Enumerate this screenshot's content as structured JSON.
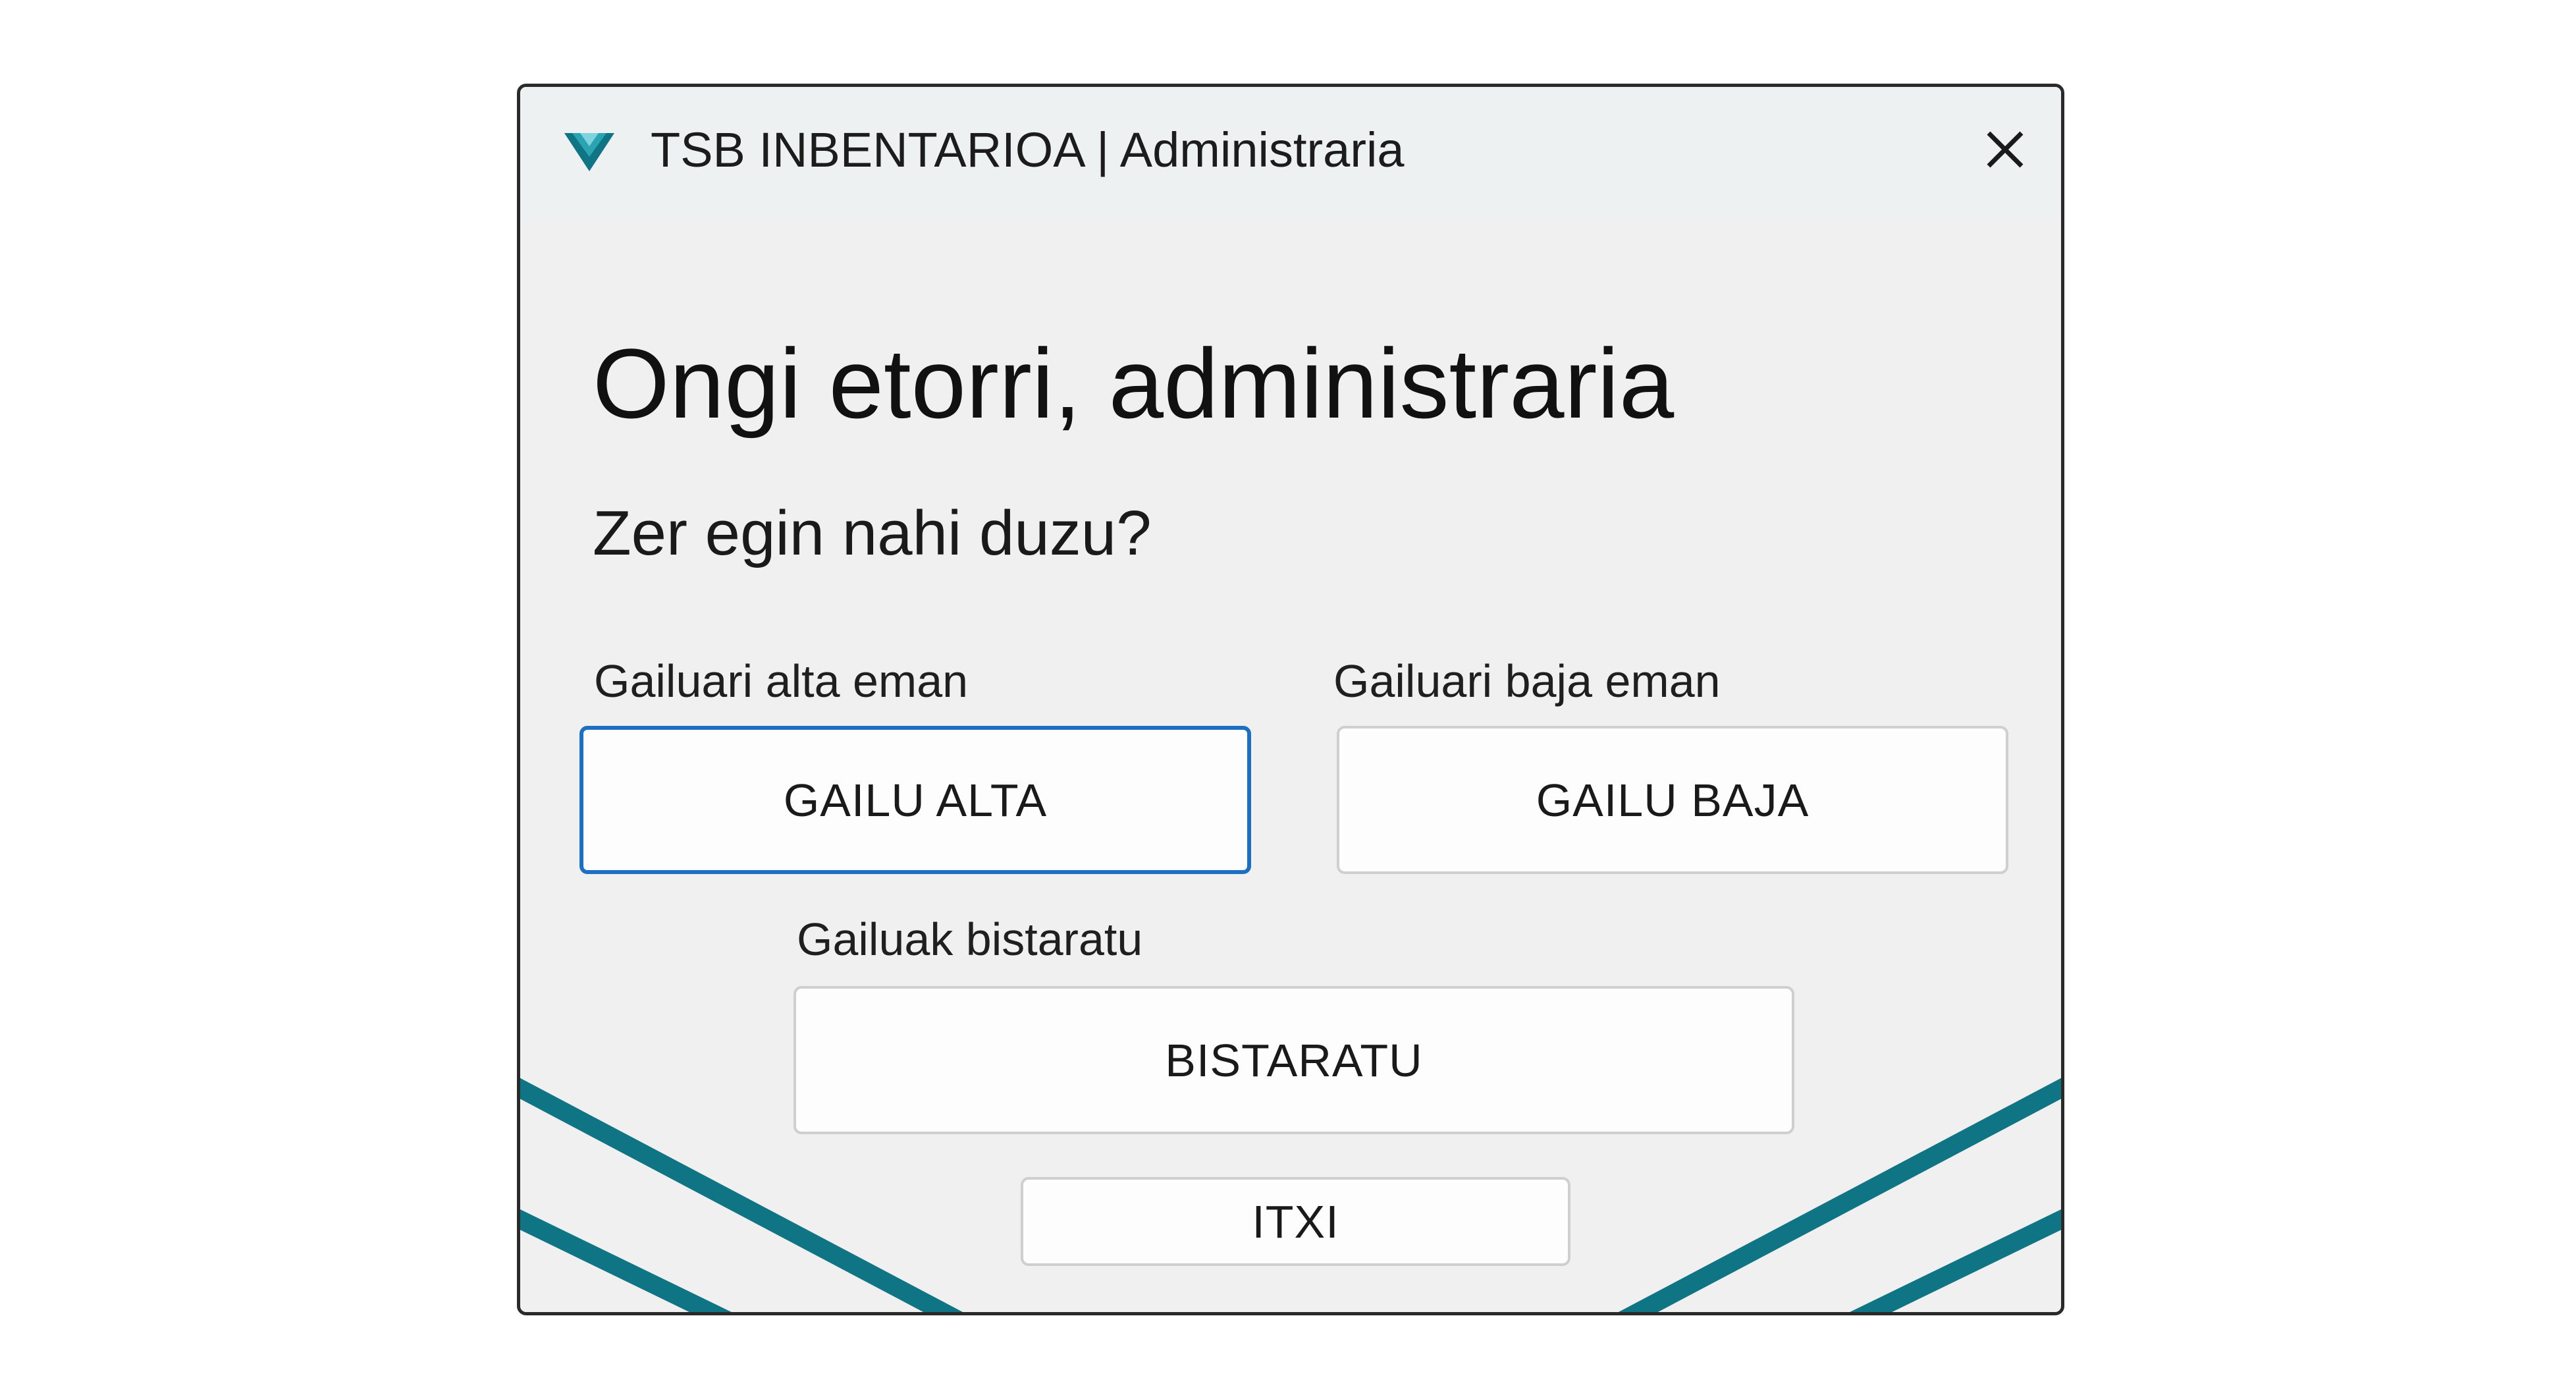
{
  "window": {
    "title": "TSB INBENTARIOA | Administraria",
    "icon": "teal-diamond-icon",
    "close_icon": "close-icon"
  },
  "main": {
    "heading": "Ongi etorri, administraria",
    "subheading": "Zer egin nahi duzu?"
  },
  "actions": {
    "alta": {
      "label": "Gailuari alta eman",
      "button": "GAILU ALTA"
    },
    "baja": {
      "label": "Gailuari baja eman",
      "button": "GAILU BAJA"
    },
    "bistaratu": {
      "label": "Gailuak bistaratu",
      "button": "BISTARATU"
    },
    "itxi": {
      "button": "ITXI"
    }
  },
  "colors": {
    "accent": "#0f7484",
    "focus": "#1d6fc4",
    "window_bg": "#f0f0f0"
  }
}
